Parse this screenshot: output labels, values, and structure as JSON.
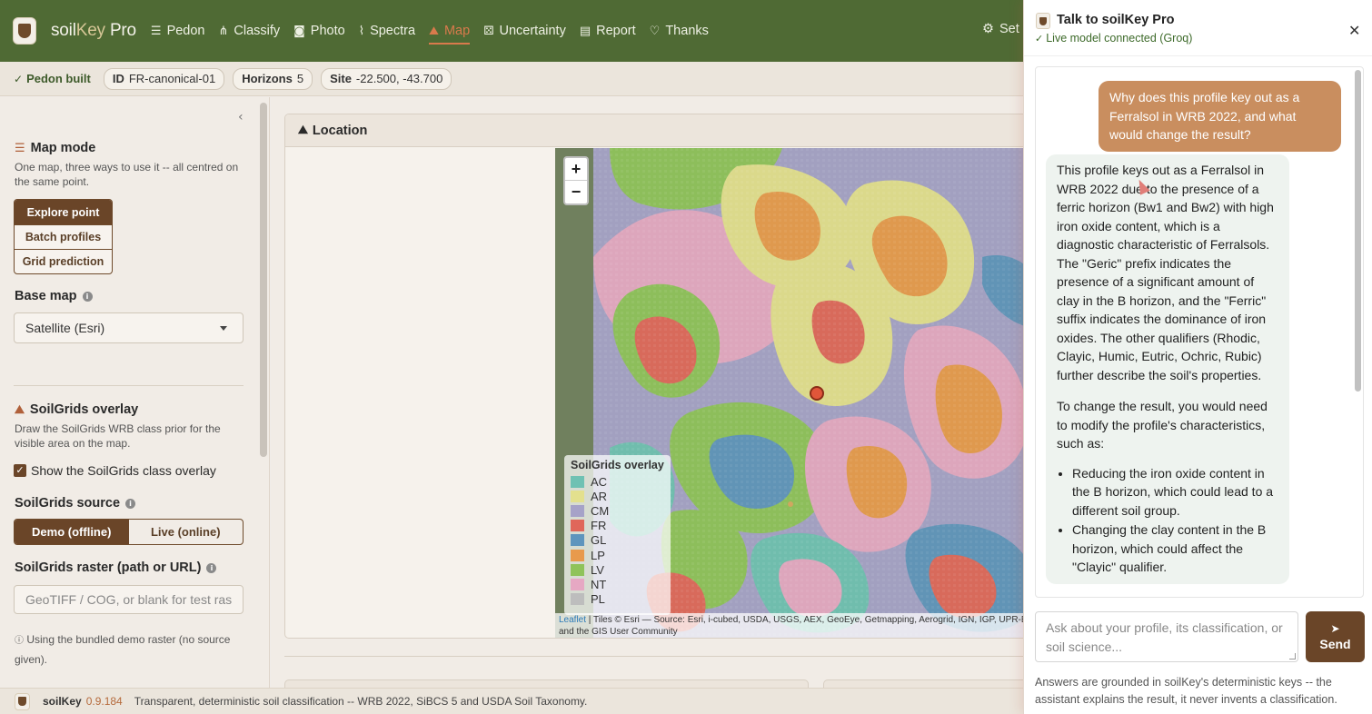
{
  "brand": {
    "prefix": "soil",
    "key": "Key",
    "suffix": " Pro"
  },
  "nav": {
    "items": [
      {
        "label": "Pedon",
        "icon": "layers-icon",
        "glyph": "☰"
      },
      {
        "label": "Classify",
        "icon": "sitemap-icon",
        "glyph": "⋔"
      },
      {
        "label": "Photo",
        "icon": "camera-icon",
        "glyph": "◙"
      },
      {
        "label": "Spectra",
        "icon": "wave-icon",
        "glyph": "⌇"
      },
      {
        "label": "Map",
        "icon": "map-icon",
        "glyph": "⛰",
        "active": true
      },
      {
        "label": "Uncertainty",
        "icon": "dice-icon",
        "glyph": "⚄"
      },
      {
        "label": "Report",
        "icon": "file-icon",
        "glyph": "▤"
      },
      {
        "label": "Thanks",
        "icon": "heart-icon",
        "glyph": "♡"
      }
    ],
    "settings_label": "Set",
    "accent_color": "#d97a4c",
    "bar_color": "#4f6a34"
  },
  "status": {
    "pedon_built": "Pedon built",
    "id_label": "ID",
    "id_value": "FR-canonical-01",
    "horizons_label": "Horizons",
    "horizons_value": "5",
    "site_label": "Site",
    "site_value": "-22.500, -43.700"
  },
  "sidebar": {
    "map_mode_title": "Map mode",
    "map_mode_desc": "One map, three ways to use it -- all centred on the same point.",
    "modes": [
      "Explore point",
      "Batch profiles",
      "Grid prediction"
    ],
    "base_map_label": "Base map",
    "base_map_value": "Satellite (Esri)",
    "overlay_title": "SoilGrids overlay",
    "overlay_desc": "Draw the SoilGrids WRB class prior for the visible area on the map.",
    "overlay_checkbox": "Show the SoilGrids class overlay",
    "source_label": "SoilGrids source",
    "source_options": [
      "Demo (offline)",
      "Live (online)"
    ],
    "raster_label": "SoilGrids raster (path or URL)",
    "raster_placeholder": "GeoTIFF / COG, or blank for test ras",
    "note": "Using the bundled demo raster (no source given)."
  },
  "main": {
    "card_title": "Location",
    "zoom_in": "+",
    "zoom_out": "−",
    "legend_title": "SoilGrids overlay",
    "legend": [
      {
        "code": "AC",
        "color": "#6fc1b3"
      },
      {
        "code": "AR",
        "color": "#e3e08e"
      },
      {
        "code": "CM",
        "color": "#a6a2c8"
      },
      {
        "code": "FR",
        "color": "#e0675a"
      },
      {
        "code": "GL",
        "color": "#5f95bd"
      },
      {
        "code": "LP",
        "color": "#e89a4c"
      },
      {
        "code": "LV",
        "color": "#8fc35a"
      },
      {
        "code": "NT",
        "color": "#e6a8c3"
      },
      {
        "code": "PL",
        "color": "#bdbdbd"
      }
    ],
    "attrib_leaflet": "Leaflet",
    "attrib_text": " | Tiles © Esri — Source: Esri, i-cubed, USDA, USGS, AEX, GeoEye, Getmapping, Aerogrid, IGN, IGP, UPR-EGP, and the GIS User Community"
  },
  "footer": {
    "name": "soilKey",
    "version": "0.9.184",
    "tagline": "Transparent, deterministic soil classification -- WRB 2022, SiBCS 5 and USDA Soil Taxonomy."
  },
  "chat": {
    "title": "Talk to soilKey Pro",
    "status": "Live model connected (Groq)",
    "user_message": "Why does this profile key out as a Ferralsol in WRB 2022, and what would change the result?",
    "bot_p1": "This profile keys out as a Ferralsol in WRB 2022 due to the presence of a ferric horizon (Bw1 and Bw2) with high iron oxide content, which is a diagnostic characteristic of Ferralsols. The \"Geric\" prefix indicates the presence of a significant amount of clay in the B horizon, and the \"Ferric\" suffix indicates the dominance of iron oxides. The other qualifiers (Rhodic, Clayic, Humic, Eutric, Ochric, Rubic) further describe the soil's properties.",
    "bot_p2": "To change the result, you would need to modify the profile's characteristics, such as:",
    "bot_bullets": [
      "Reducing the iron oxide content in the B horizon, which could lead to a different soil group.",
      "Changing the clay content in the B horizon, which could affect the \"Clayic\" qualifier."
    ],
    "input_placeholder": "Ask about your profile, its classification, or soil science...",
    "send_label": "Send",
    "footnote": "Answers are grounded in soilKey's deterministic keys -- the assistant explains the result, it never invents a classification."
  }
}
